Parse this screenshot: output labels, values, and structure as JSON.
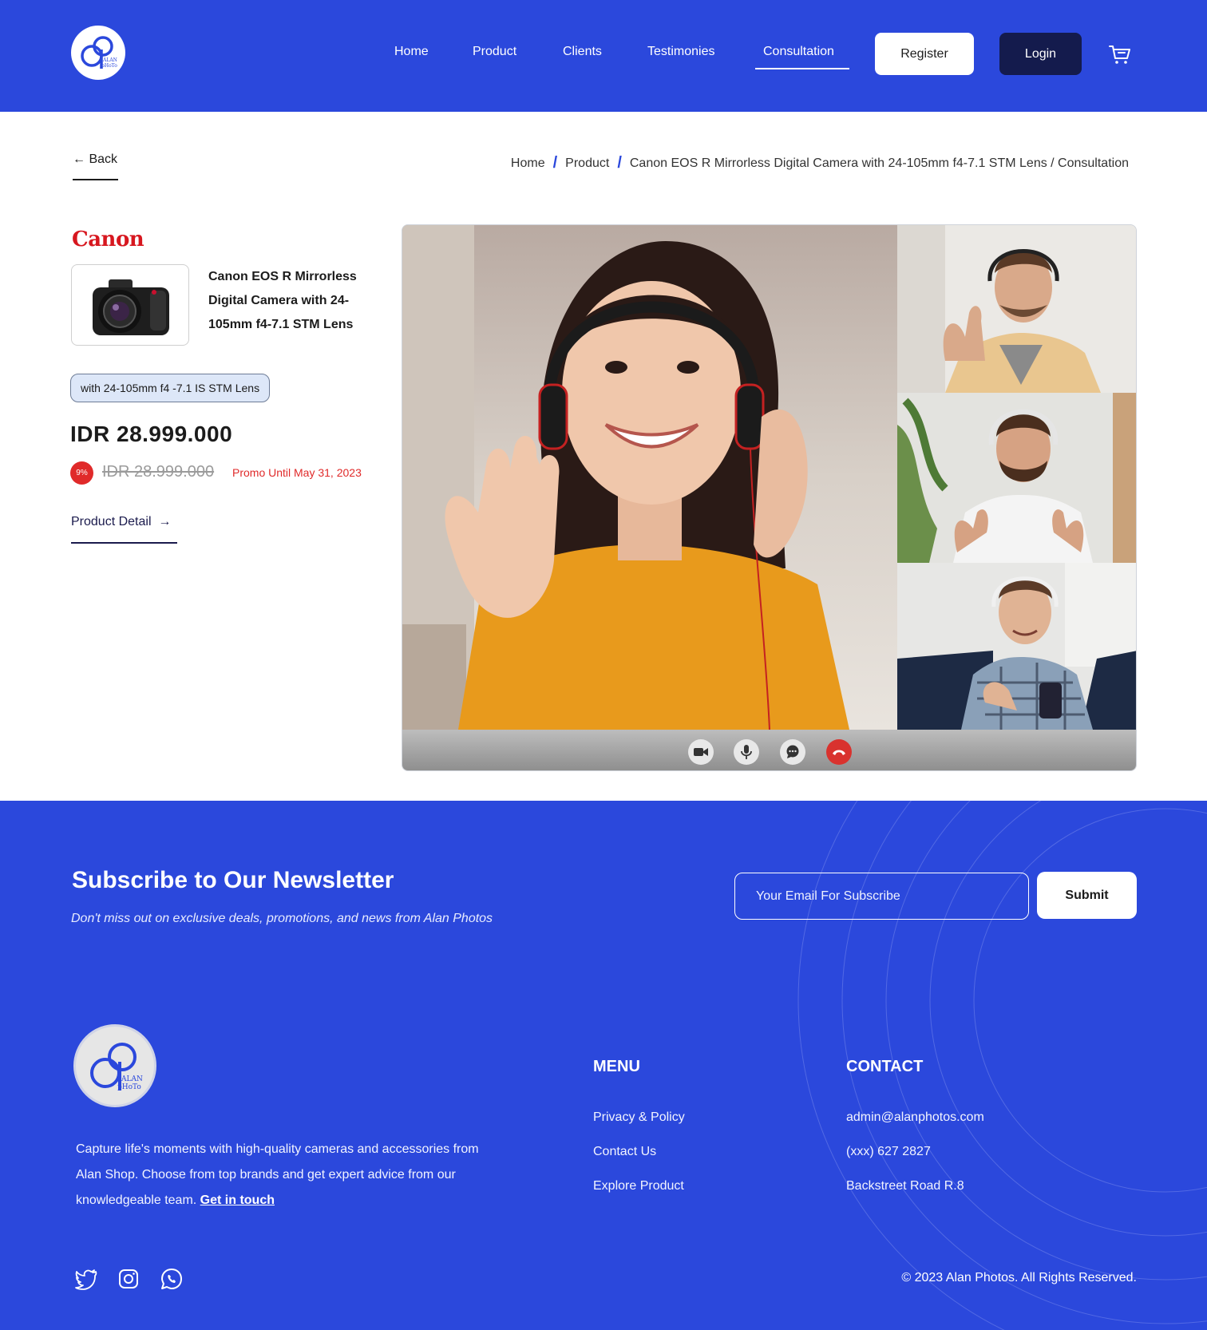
{
  "brand": {
    "logo_text_top": "ALAN",
    "logo_text_bottom": "pHoTo"
  },
  "nav": {
    "items": [
      "Home",
      "Product",
      "Clients",
      "Testimonies",
      "Consultation"
    ],
    "active": "Consultation",
    "register": "Register",
    "login": "Login"
  },
  "back": {
    "label": "Back"
  },
  "breadcrumb": {
    "home": "Home",
    "product": "Product",
    "current": "Canon EOS R Mirrorless Digital Camera with 24-105mm f4-7.1 STM Lens / Consultation"
  },
  "product": {
    "brand_logo": "Canon",
    "name": "Canon EOS R Mirrorless Digital Camera with 24-105mm f4-7.1 STM Lens",
    "variant": "with 24-105mm f4 -7.1 IS STM Lens",
    "price": "IDR 28.999.000",
    "discount": "9%",
    "old_price": "IDR 28.999.000",
    "promo": "Promo Until May 31, 2023",
    "detail_link": "Product Detail"
  },
  "call": {
    "controls": [
      "video-camera-icon",
      "microphone-icon",
      "chat-icon",
      "end-call-icon"
    ],
    "end_color": "#d9322e"
  },
  "newsletter": {
    "title": "Subscribe to Our Newsletter",
    "subtitle": "Don't miss out on exclusive deals, promotions, and news from Alan Photos",
    "placeholder": "Your Email For Subscribe",
    "submit": "Submit"
  },
  "footer": {
    "description": "Capture life's moments with high-quality cameras and accessories from Alan Shop. Choose from top brands and get expert advice from our knowledgeable team.",
    "cta": "Get in touch",
    "menu_title": "MENU",
    "menu_items": [
      "Privacy & Policy",
      "Contact Us",
      "Explore Product"
    ],
    "contact_title": "CONTACT",
    "contact_items": [
      "admin@alanphotos.com",
      "(xxx) 627 2827",
      "Backstreet Road R.8"
    ],
    "social": [
      "twitter-icon",
      "instagram-icon",
      "whatsapp-icon"
    ],
    "copyright": "© 2023 Alan Photos. All Rights Reserved."
  },
  "colors": {
    "primary": "#2b48dc",
    "dark": "#141b4d",
    "danger": "#e02a2a",
    "canon": "#d7171f"
  }
}
